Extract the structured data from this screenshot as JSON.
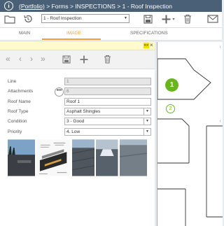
{
  "header": {
    "info_icon": "i",
    "breadcrumb_link": "(Portfolio)",
    "breadcrumb_rest": " > Forms > INSPECTIONS > 1 - Roof Inspection"
  },
  "toolbar": {
    "record_select": "1 - Roof Inspection",
    "icons": [
      "folder-icon",
      "history-icon",
      "save-icon",
      "add-icon",
      "delete-icon",
      "mail-icon"
    ]
  },
  "tabs": [
    {
      "label": "MAIN"
    },
    {
      "label": "IMAGE"
    },
    {
      "label": "SPECIFICATIONS"
    }
  ],
  "panel": {
    "expand_label": "«»",
    "close_label": "×"
  },
  "form": {
    "line": {
      "label": "Line",
      "value": "1"
    },
    "attachments": {
      "label": "Attachments",
      "value": "6"
    },
    "roof_name": {
      "label": "Roof Name",
      "value": "Roof 1"
    },
    "roof_type": {
      "label": "Roof Type",
      "value": "Asphalt Shingles"
    },
    "condition": {
      "label": "Condition",
      "value": "3 - Good"
    },
    "priority": {
      "label": "Priority",
      "value": "4. Low"
    }
  },
  "drawing": {
    "marker_1": "1",
    "marker_2": "2"
  },
  "colors": {
    "titlebar": "#4a6076",
    "accent": "#f0a33a",
    "marker_green": "#6ab51e"
  }
}
